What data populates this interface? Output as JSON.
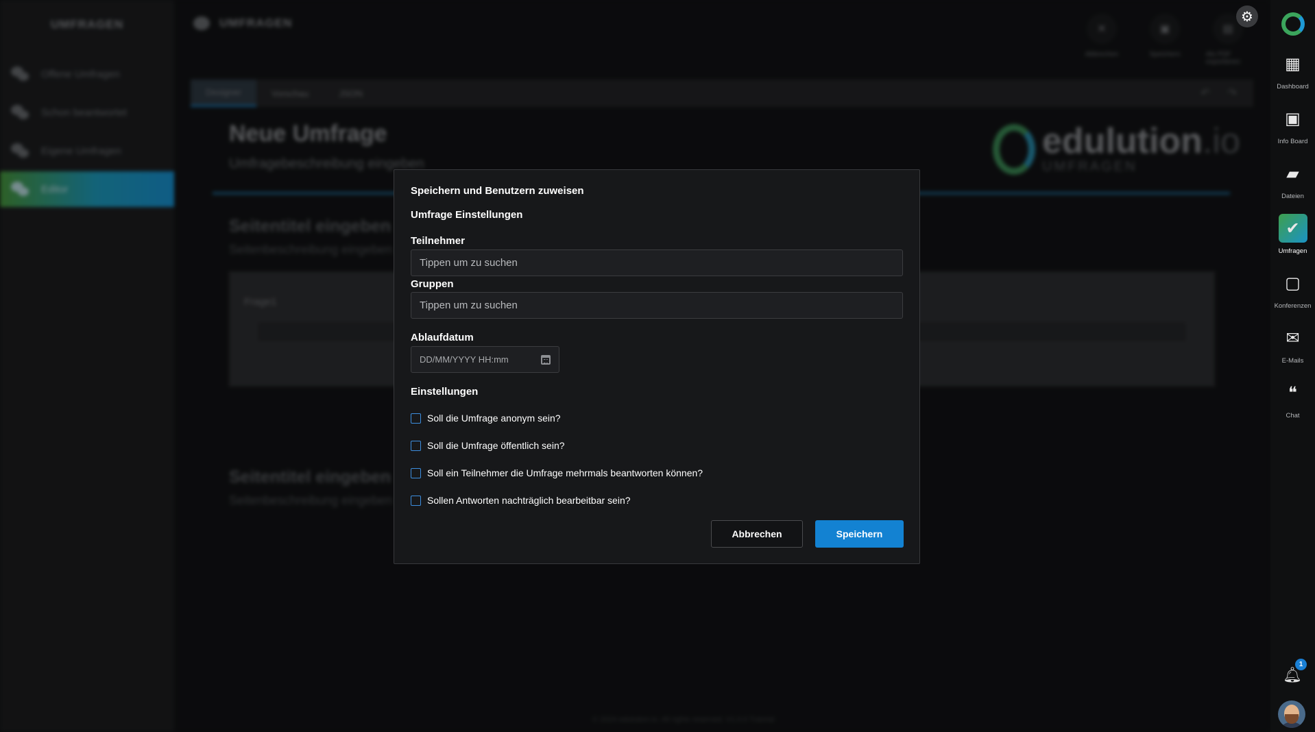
{
  "sidebar": {
    "title": "UMFRAGEN",
    "items": [
      {
        "label": "Offene Umfragen"
      },
      {
        "label": "Schon beantwortet"
      },
      {
        "label": "Eigene Umfragen"
      },
      {
        "label": "Editor"
      }
    ]
  },
  "header": {
    "title": "UMFRAGEN",
    "toolbar": [
      {
        "label": "Abbrechen",
        "icon": "close-icon"
      },
      {
        "label": "Speichern",
        "icon": "save-icon"
      },
      {
        "label": "Als PDF exportieren",
        "icon": "pdf-icon"
      }
    ]
  },
  "editor": {
    "tabs": [
      "Designer",
      "Vorschau",
      "JSON"
    ],
    "survey_title": "Neue Umfrage",
    "survey_description": "Umfragebeschreibung eingeben",
    "brand_name": "edulution",
    "brand_suffix": ".io",
    "brand_sub": "UMFRAGEN",
    "page1_title": "Seitentitel eingeben",
    "page1_desc": "Seitenbeschreibung eingeben",
    "question_label": "Frage1",
    "page2_title": "Seitentitel eingeben",
    "page2_desc": "Seitenbeschreibung eingeben",
    "footer": "© 2024 edulution.io. All rights reserved. V1.0.0   Tutorial"
  },
  "rail": {
    "items": [
      {
        "label": "Dashboard",
        "icon": "dashboard-icon"
      },
      {
        "label": "Info Board",
        "icon": "info-board-icon"
      },
      {
        "label": "Dateien",
        "icon": "files-icon"
      },
      {
        "label": "Umfragen",
        "icon": "surveys-icon",
        "active": true
      },
      {
        "label": "Konferenzen",
        "icon": "conferences-icon"
      },
      {
        "label": "E-Mails",
        "icon": "mail-icon"
      },
      {
        "label": "Chat",
        "icon": "chat-icon"
      }
    ],
    "notification_count": "1"
  },
  "modal": {
    "title": "Speichern und Benutzern zuweisen",
    "subtitle": "Umfrage Einstellungen",
    "participants_label": "Teilnehmer",
    "participants_placeholder": "Tippen um zu suchen",
    "groups_label": "Gruppen",
    "groups_placeholder": "Tippen um zu suchen",
    "expiry_label": "Ablaufdatum",
    "expiry_placeholder": "DD/MM/YYYY HH:mm",
    "settings_label": "Einstellungen",
    "options": [
      {
        "label": "Soll die Umfrage anonym sein?",
        "checked": false
      },
      {
        "label": "Soll die Umfrage öffentlich sein?",
        "checked": false
      },
      {
        "label": "Soll ein Teilnehmer die Umfrage mehrmals beantworten können?",
        "checked": false
      },
      {
        "label": "Sollen Antworten nachträglich bearbeitbar sein?",
        "checked": false
      }
    ],
    "cancel_label": "Abbrechen",
    "save_label": "Speichern"
  },
  "colors": {
    "accent": "#1382d2",
    "checkbox_border": "#3d8fe0",
    "active_gradient_start": "#3e9f4e",
    "active_gradient_end": "#1b93c4"
  }
}
